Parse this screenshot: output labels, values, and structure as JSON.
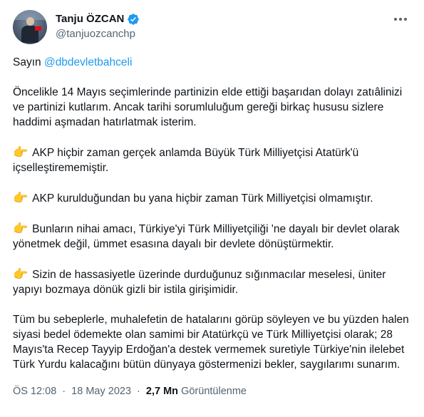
{
  "author": {
    "display_name": "Tanju ÖZCAN",
    "handle": "@tanjuozcanchp",
    "verified_icon": "verified-badge-icon",
    "avatar_icon": "avatar-photo"
  },
  "menu_icon": "more-dots-icon",
  "tweet": {
    "greeting_prefix": "Sayın ",
    "mention": "@dbdevletbahceli",
    "intro": "Öncelikle 14 Mayıs seçimlerinde partinizin elde ettiği başarıdan dolayı zatıâlinizi ve partinizi kutlarım. Ancak tarihi sorumluluğum gereği birkaç hususu sizlere haddimi aşmadan hatırlatmak isterim.",
    "points_icon": "👉",
    "points": [
      "AKP hiçbir zaman gerçek anlamda Büyük Türk Milliyetçisi Atatürk'ü içselleştirememiştir.",
      "AKP kurulduğundan bu yana hiçbir zaman Türk Milliyetçisi olmamıştır.",
      "Bunların nihai amacı, Türkiye'yi Türk Milliyetçiliği 'ne dayalı bir devlet olarak yönetmek değil, ümmet esasına dayalı bir devlete dönüştürmektir.",
      "Sizin de hassasiyetle üzerinde durduğunuz sığınmacılar meselesi, üniter yapıyı bozmaya dönük gizli bir istila girişimidir."
    ],
    "closing": "Tüm bu sebeplerle, muhalefetin de hatalarını görüp söyleyen ve bu yüzden halen siyasi bedel ödemekte olan samimi bir Atatürkçü ve Türk Milliyetçisi olarak; 28 Mayıs'ta Recep Tayyip Erdoğan'a destek vermemek suretiyle Türkiye'nin ilelebet Türk Yurdu kalacağını bütün dünyaya göstermenizi bekler, saygılarımı sunarım."
  },
  "meta": {
    "time": "ÖS 12:08",
    "date": "18 May 2023",
    "separator": "·",
    "views_count": "2,7 Mn",
    "views_label": "Görüntülenme"
  },
  "colors": {
    "accent": "#1d9bf0",
    "text": "#0f1419",
    "secondary": "#536471"
  }
}
